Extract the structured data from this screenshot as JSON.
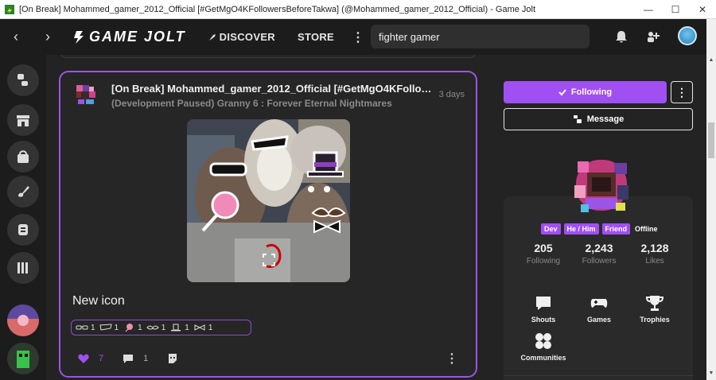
{
  "window": {
    "title": "[On Break] Mohammed_gamer_2012_Official [#GetMgO4KFollowersBeforeTakwa] (@Mohammed_gamer_2012_Official) - Game Jolt",
    "minimize": "—",
    "maximize": "☐",
    "close": "✕"
  },
  "topbar": {
    "back": "‹",
    "forward": "›",
    "logo": "GAME JOLT",
    "discover": "DISCOVER",
    "store": "STORE",
    "more": "⋮",
    "search_value": "fighter gamer"
  },
  "post": {
    "author": "[On Break] Mohammed_gamer_2012_Official [#GetMgO4KFollowersBeforeTakwa]",
    "time": "3 days",
    "game": "(Development Paused) Granny 6 : Forever Eternal Nightmares",
    "heading": "New icon",
    "stickers": [
      {
        "icon": "sunglasses-sticker-icon",
        "count": "1"
      },
      {
        "icon": "mask-sticker-icon",
        "count": "1"
      },
      {
        "icon": "lollipop-sticker-icon",
        "count": "1"
      },
      {
        "icon": "mustache-sticker-icon",
        "count": "1"
      },
      {
        "icon": "top-hat-sticker-icon",
        "count": "1"
      },
      {
        "icon": "bowtie-sticker-icon",
        "count": "1"
      }
    ],
    "likes": "7",
    "comments": "1",
    "more": "⋮"
  },
  "profile": {
    "following_button": "Following",
    "message_button": "Message",
    "tags": [
      "Dev",
      "He / Him",
      "Friend"
    ],
    "status": "Offline",
    "stats": [
      {
        "num": "205",
        "label": "Following"
      },
      {
        "num": "2,243",
        "label": "Followers"
      },
      {
        "num": "2,128",
        "label": "Likes"
      }
    ],
    "links": [
      "Shouts",
      "Games",
      "Trophies",
      "Communities"
    ]
  },
  "colors": {
    "accent": "#a04ff2",
    "background": "#1c1c1c",
    "card": "#262626"
  }
}
